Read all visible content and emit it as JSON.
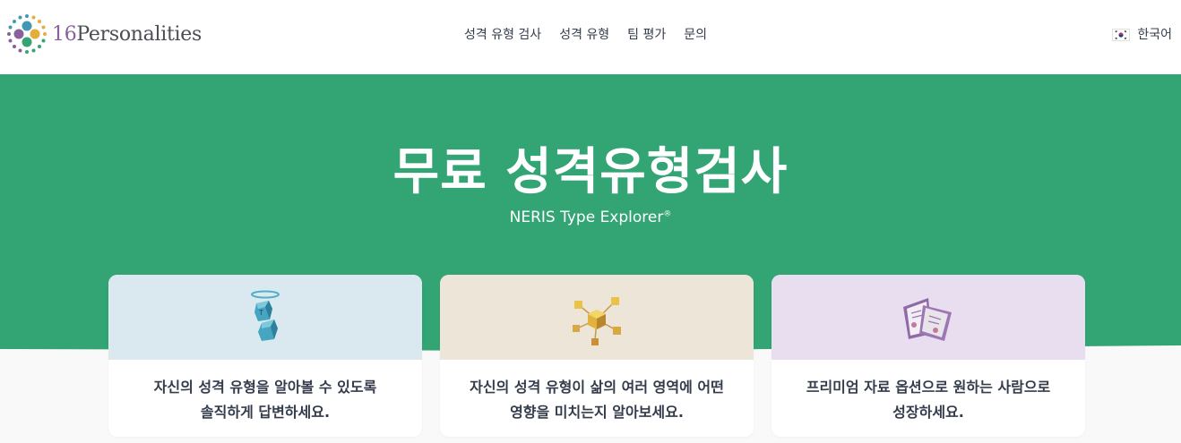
{
  "header": {
    "logo_num": "16",
    "logo_word": "Personalities",
    "nav": [
      "성격 유형 검사",
      "성격 유형",
      "팀 평가",
      "문의"
    ],
    "language": "한국어"
  },
  "hero": {
    "title": "무료 성격유형검사",
    "subtitle": "NERIS Type Explorer",
    "subtitle_mark": "®"
  },
  "cards": [
    {
      "text_line1": "자신의 성격 유형을 알아볼 수 있도록",
      "text_line2": "솔직하게 답변하세요.",
      "bg": "#d9e9ef"
    },
    {
      "text_line1": "자신의 성격 유형이 삶의 여러 영역에 어떤",
      "text_line2": "영향을 미치는지 알아보세요.",
      "bg": "#ece5d8"
    },
    {
      "text_line1": "프리미엄 자료 옵션으로 원하는 사람으로",
      "text_line2": "성장하세요.",
      "bg": "#e9def0"
    }
  ],
  "colors": {
    "brand_green": "#33a474",
    "logo_purple": "#88619a",
    "text_dark": "#343c4b"
  }
}
